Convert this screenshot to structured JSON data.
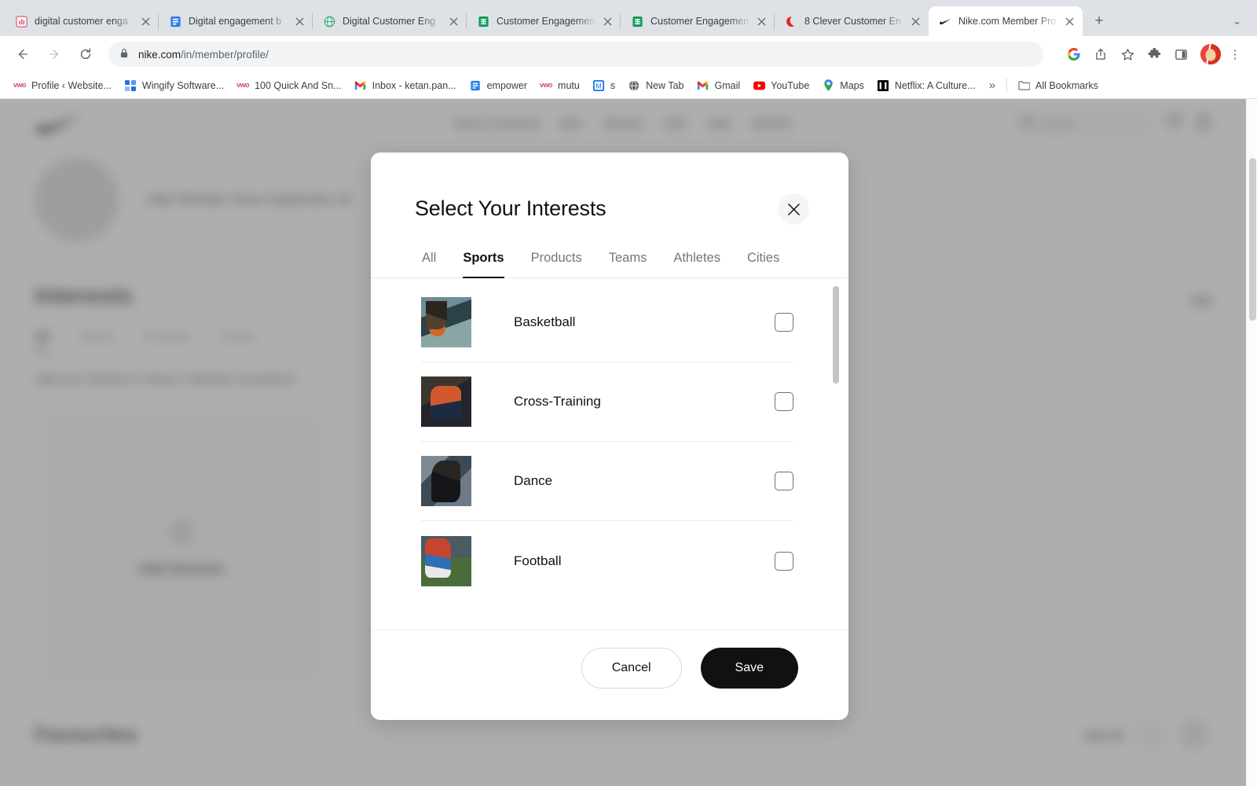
{
  "browser": {
    "tabs": [
      {
        "title": "digital customer enga",
        "favicon": "chart-icon",
        "active": false
      },
      {
        "title": "Digital engagement b",
        "favicon": "doc-icon",
        "active": false
      },
      {
        "title": "Digital Customer Eng",
        "favicon": "globe-icon",
        "active": false
      },
      {
        "title": "Customer Engagemen",
        "favicon": "sheets-icon",
        "active": false
      },
      {
        "title": "Customer Engagemen",
        "favicon": "sheets-icon",
        "active": false
      },
      {
        "title": "8 Clever Customer En",
        "favicon": "red-circle-icon",
        "active": false
      },
      {
        "title": "Nike.com Member Pro",
        "favicon": "nike-swoosh-icon",
        "active": true
      }
    ],
    "new_tab_label": "+",
    "tab_list_chevron": "⌄",
    "nav": {
      "back": "←",
      "forward": "→",
      "reload": "⟳"
    },
    "omnibox": {
      "lock_icon": "lock-icon",
      "url_domain": "nike.com",
      "url_path": "/in/member/profile/",
      "full_url": "nike.com/in/member/profile/"
    },
    "toolbar_icons": [
      {
        "name": "google-lens-icon",
        "glyph": "G"
      },
      {
        "name": "share-icon",
        "glyph": "⇪"
      },
      {
        "name": "bookmark-star-icon",
        "glyph": "☆"
      },
      {
        "name": "extensions-puzzle-icon",
        "glyph": "🧩"
      },
      {
        "name": "side-panel-icon",
        "glyph": "▢"
      }
    ],
    "profile_avatar": "user-avatar",
    "menu_icon": "⋮",
    "bookmarks": [
      {
        "label": "Profile ‹ Website...",
        "icon": "vwo-icon"
      },
      {
        "label": "Wingify Software...",
        "icon": "wingify-icon"
      },
      {
        "label": "100 Quick And Sn...",
        "icon": "vwo-icon"
      },
      {
        "label": "Inbox - ketan.pan...",
        "icon": "gmail-icon"
      },
      {
        "label": "empower",
        "icon": "doc-icon"
      },
      {
        "label": "mutu",
        "icon": "vwo-icon"
      },
      {
        "label": "s",
        "icon": "blue-m-icon"
      },
      {
        "label": "New Tab",
        "icon": "globe-icon"
      },
      {
        "label": "Gmail",
        "icon": "gmail-icon"
      },
      {
        "label": "YouTube",
        "icon": "youtube-icon"
      },
      {
        "label": "Maps",
        "icon": "maps-pin-icon"
      },
      {
        "label": "Netflix: A Culture...",
        "icon": "netflix-icon"
      }
    ],
    "bookmarks_overflow": "»",
    "all_bookmarks_label": "All Bookmarks",
    "all_bookmarks_icon": "folder-icon"
  },
  "page": {
    "nav_links": [
      "New & Featured",
      "Men",
      "Women",
      "Kids",
      "Sale",
      "SNKRS"
    ],
    "search_placeholder": "Search",
    "search_icon": "search-icon",
    "favourite_icon": "heart-icon",
    "bag_icon": "bag-icon",
    "member_since": "Nike Member Since September 20",
    "interests_heading": "Interests",
    "edit_label": "Edit",
    "interest_tabs": [
      "All",
      "Sports",
      "Products",
      "Teams"
    ],
    "interest_tab_active": "All",
    "interests_subtext": "Add your interests to shop a collection of products",
    "add_card_label": "Add Interests",
    "add_card_icon": "plus-icon",
    "favourites_heading": "Favourites",
    "view_all_label": "View all",
    "prev_arrow": "‹",
    "next_arrow": "›"
  },
  "modal": {
    "title": "Select Your Interests",
    "close_icon": "×",
    "tabs": [
      {
        "label": "All",
        "active": false
      },
      {
        "label": "Sports",
        "active": true
      },
      {
        "label": "Products",
        "active": false
      },
      {
        "label": "Teams",
        "active": false
      },
      {
        "label": "Athletes",
        "active": false
      },
      {
        "label": "Cities",
        "active": false
      }
    ],
    "items": [
      {
        "label": "Basketball",
        "checked": false,
        "thumb": "basketball-photo"
      },
      {
        "label": "Cross-Training",
        "checked": false,
        "thumb": "cross-training-photo"
      },
      {
        "label": "Dance",
        "checked": false,
        "thumb": "dance-photo"
      },
      {
        "label": "Football",
        "checked": false,
        "thumb": "football-photo"
      }
    ],
    "cancel_label": "Cancel",
    "save_label": "Save"
  },
  "colors": {
    "accent_black": "#111111",
    "tab_strip": "#dee1e6",
    "omnibox_bg": "#f1f3f4",
    "scrim": "rgba(125,125,125,0.62)",
    "checkbox_border": "#707072"
  }
}
